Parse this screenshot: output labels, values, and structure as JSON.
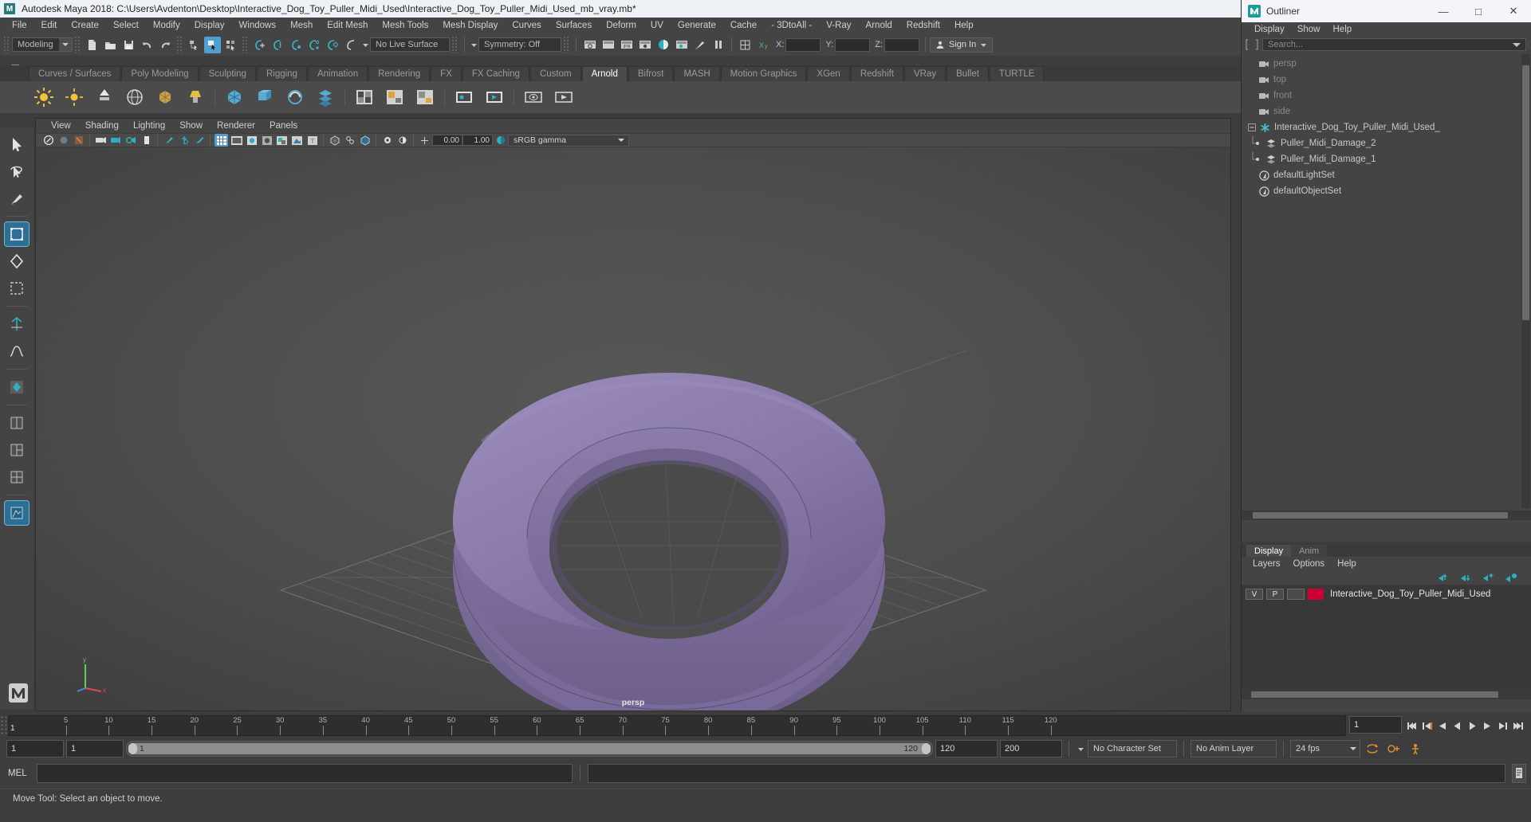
{
  "window": {
    "title": "Autodesk Maya 2018: C:\\Users\\Avdenton\\Desktop\\Interactive_Dog_Toy_Puller_Midi_Used\\Interactive_Dog_Toy_Puller_Midi_Used_mb_vray.mb*",
    "logo_text": "M"
  },
  "menubar": {
    "items": [
      "File",
      "Edit",
      "Create",
      "Select",
      "Modify",
      "Display",
      "Windows",
      "Mesh",
      "Edit Mesh",
      "Mesh Tools",
      "Mesh Display",
      "Curves",
      "Surfaces",
      "Deform",
      "UV",
      "Generate",
      "Cache",
      "- 3DtoAll -",
      "V-Ray",
      "Arnold",
      "Redshift",
      "Help"
    ]
  },
  "statusbar": {
    "menuset": "Modeling",
    "live_surface": "No Live Surface",
    "symmetry": "Symmetry: Off",
    "coord_labels": [
      "X:",
      "Y:",
      "Z:"
    ],
    "coord_values": [
      "",
      "",
      ""
    ],
    "signin_label": "Sign In",
    "ipr_label": "IPR"
  },
  "shelf": {
    "tabs": [
      {
        "label": "Curves / Surfaces",
        "selected": false
      },
      {
        "label": "Poly Modeling",
        "selected": false
      },
      {
        "label": "Sculpting",
        "selected": false
      },
      {
        "label": "Rigging",
        "selected": false
      },
      {
        "label": "Animation",
        "selected": false
      },
      {
        "label": "Rendering",
        "selected": false
      },
      {
        "label": "FX",
        "selected": false
      },
      {
        "label": "FX Caching",
        "selected": false
      },
      {
        "label": "Custom",
        "selected": false
      },
      {
        "label": "Arnold",
        "selected": true
      },
      {
        "label": "Bifrost",
        "selected": false
      },
      {
        "label": "MASH",
        "selected": false
      },
      {
        "label": "Motion Graphics",
        "selected": false
      },
      {
        "label": "XGen",
        "selected": false
      },
      {
        "label": "Redshift",
        "selected": false
      },
      {
        "label": "VRay",
        "selected": false
      },
      {
        "label": "Bullet",
        "selected": false
      },
      {
        "label": "TURTLE",
        "selected": false
      }
    ]
  },
  "viewport": {
    "menus": [
      "View",
      "Shading",
      "Lighting",
      "Show",
      "Renderer",
      "Panels"
    ],
    "exposure": "0.00",
    "gamma": "1.00",
    "color_space": "sRGB gamma",
    "camera_label": "persp",
    "model_color": "#8a7aa8",
    "grid_color": "#6a6a6a",
    "pivot_color": "#e0335e"
  },
  "outliner": {
    "title": "Outliner",
    "window_buttons": [
      "minimize",
      "maximize",
      "close"
    ],
    "menus": [
      "Display",
      "Show",
      "Help"
    ],
    "search_placeholder": "Search...",
    "items": [
      {
        "label": "persp",
        "icon": "camera-icon",
        "dim": true,
        "indent": 1
      },
      {
        "label": "top",
        "icon": "camera-icon",
        "dim": true,
        "indent": 1
      },
      {
        "label": "front",
        "icon": "camera-icon",
        "dim": true,
        "indent": 1
      },
      {
        "label": "side",
        "icon": "camera-icon",
        "dim": true,
        "indent": 1
      },
      {
        "label": "Interactive_Dog_Toy_Puller_Midi_Used_",
        "icon": "group-icon",
        "dim": false,
        "indent": 0,
        "expanded": true
      },
      {
        "label": "Puller_Midi_Damage_2",
        "icon": "mesh-icon",
        "dim": false,
        "indent": 1,
        "child": true
      },
      {
        "label": "Puller_Midi_Damage_1",
        "icon": "mesh-icon",
        "dim": false,
        "indent": 1,
        "child": true
      },
      {
        "label": "defaultLightSet",
        "icon": "set-icon",
        "dim": false,
        "indent": 1
      },
      {
        "label": "defaultObjectSet",
        "icon": "set-icon",
        "dim": false,
        "indent": 1
      }
    ]
  },
  "layer_editor": {
    "tabs": [
      {
        "label": "Display",
        "selected": true
      },
      {
        "label": "Anim",
        "selected": false
      }
    ],
    "menus": [
      "Layers",
      "Options",
      "Help"
    ],
    "layers": [
      {
        "visibility": "V",
        "playback": "P",
        "state": "",
        "color": "#cc0033",
        "name": "Interactive_Dog_Toy_Puller_Midi_Used"
      }
    ]
  },
  "timeline": {
    "tick_labels": [
      "5",
      "10",
      "15",
      "20",
      "25",
      "30",
      "35",
      "40",
      "45",
      "50",
      "55",
      "60",
      "65",
      "70",
      "75",
      "80",
      "85",
      "90",
      "95",
      "100",
      "105",
      "110",
      "115",
      "120"
    ],
    "start_label": "1",
    "current_frame": "1",
    "frame_field": "1",
    "playback_buttons": [
      "go-to-start",
      "step-back-key",
      "step-back-frame",
      "play-backwards",
      "play-forwards",
      "step-forward-frame",
      "step-forward-key",
      "go-to-end"
    ]
  },
  "range": {
    "anim_start": "1",
    "range_start": "1",
    "bar_start_label": "1",
    "bar_end_label": "120",
    "range_end": "120",
    "anim_end": "200",
    "character_set": "No Character Set",
    "anim_layer": "No Anim Layer",
    "fps": "24 fps"
  },
  "command_line": {
    "language": "MEL",
    "input_value": "",
    "output_value": ""
  },
  "help_line": {
    "text": "Move Tool: Select an object to move."
  }
}
